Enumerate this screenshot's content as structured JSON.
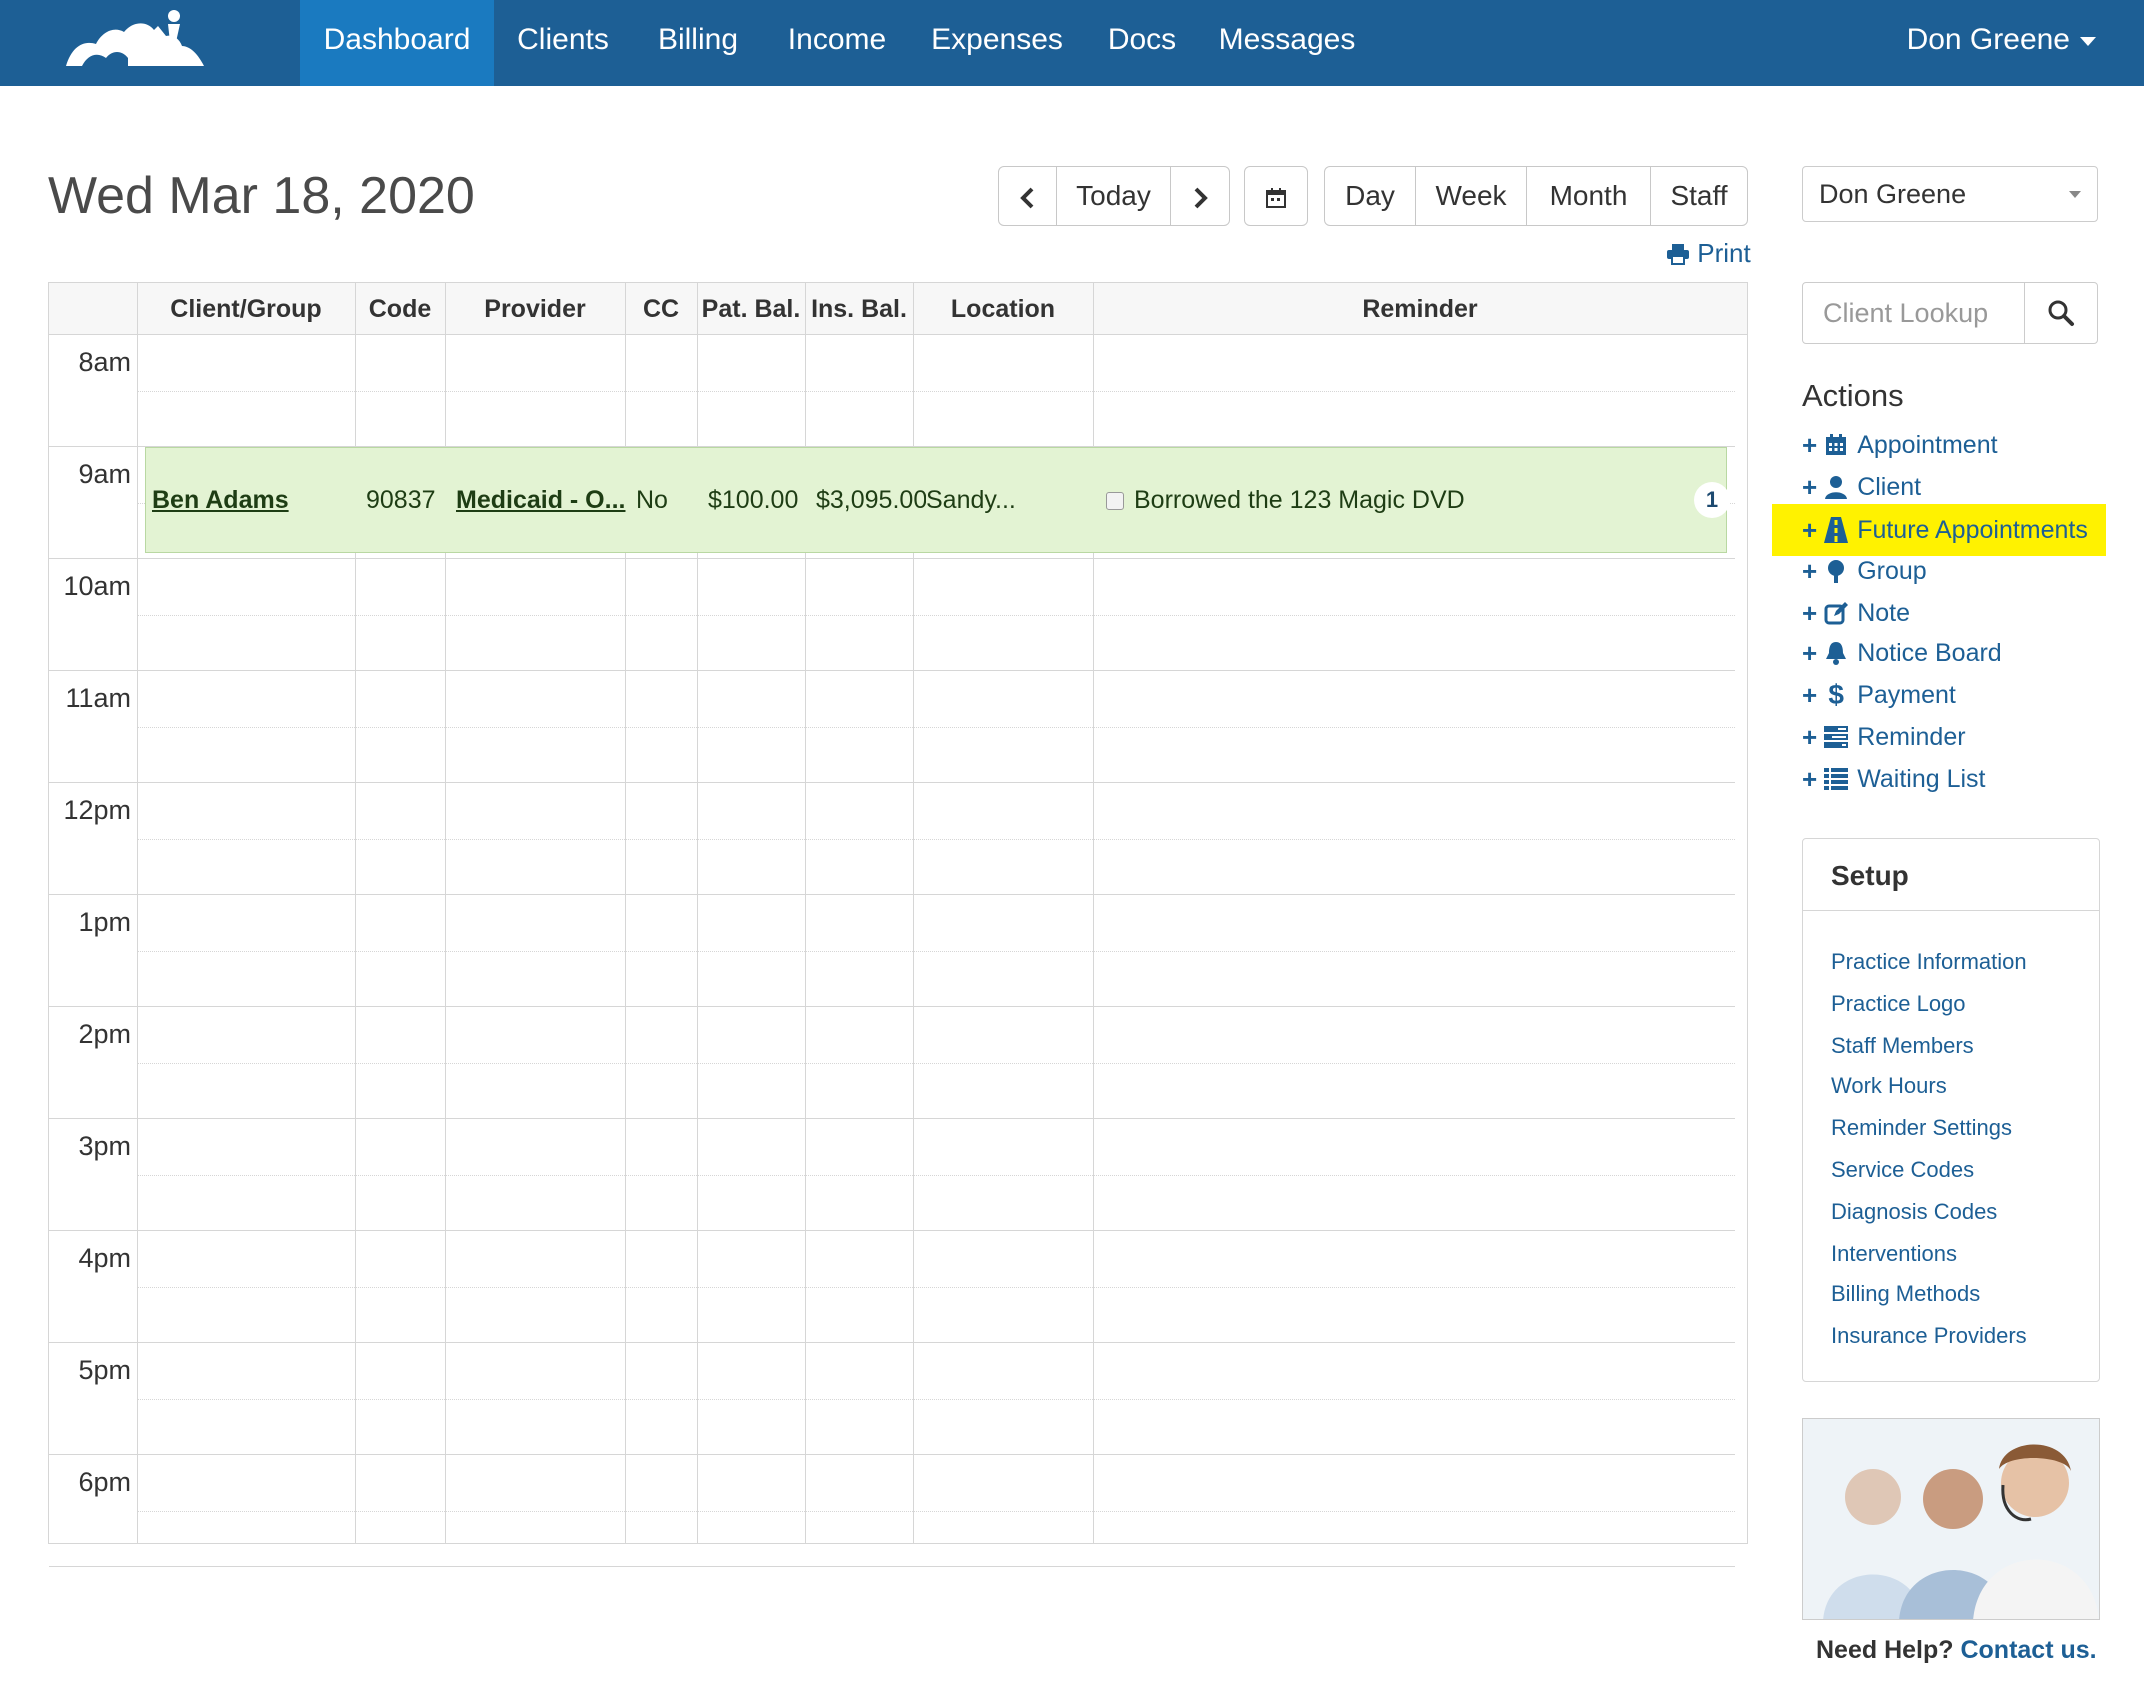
{
  "nav": {
    "items": [
      {
        "label": "Dashboard",
        "active": true
      },
      {
        "label": "Clients"
      },
      {
        "label": "Billing"
      },
      {
        "label": "Income"
      },
      {
        "label": "Expenses"
      },
      {
        "label": "Docs"
      },
      {
        "label": "Messages"
      }
    ],
    "user": "Don Greene"
  },
  "date_title": "Wed Mar 18, 2020",
  "toolbar": {
    "today": "Today",
    "views": [
      "Day",
      "Week",
      "Month",
      "Staff"
    ],
    "print": "Print"
  },
  "calendar": {
    "columns": [
      "Client/Group",
      "Code",
      "Provider",
      "CC",
      "Pat. Bal.",
      "Ins. Bal.",
      "Location",
      "Reminder"
    ],
    "hours": [
      "8am",
      "9am",
      "10am",
      "11am",
      "12pm",
      "1pm",
      "2pm",
      "3pm",
      "4pm",
      "5pm",
      "6pm"
    ],
    "appointment": {
      "client": "Ben Adams",
      "code": "90837",
      "provider": "Medicaid - O...",
      "cc": "No",
      "pat_bal": "$100.00",
      "ins_bal": "$3,095.00",
      "location": "Sandy...",
      "reminder": "Borrowed the 123 Magic DVD",
      "count": "1"
    }
  },
  "sidebar": {
    "staff_select": "Don Greene",
    "lookup_placeholder": "Client Lookup",
    "actions_title": "Actions",
    "actions": [
      {
        "label": "Appointment",
        "icon": "calendar-icon"
      },
      {
        "label": "Client",
        "icon": "user-icon"
      },
      {
        "label": "Future Appointments",
        "icon": "road-icon",
        "highlight": true
      },
      {
        "label": "Group",
        "icon": "tree-icon"
      },
      {
        "label": "Note",
        "icon": "edit-icon"
      },
      {
        "label": "Notice Board",
        "icon": "bell-icon"
      },
      {
        "label": "Payment",
        "icon": "dollar-icon"
      },
      {
        "label": "Reminder",
        "icon": "tasks-icon"
      },
      {
        "label": "Waiting List",
        "icon": "list-icon"
      }
    ],
    "setup_title": "Setup",
    "setup_links": [
      "Practice Information",
      "Practice Logo",
      "Staff Members",
      "Work Hours",
      "Reminder Settings",
      "Service Codes",
      "Diagnosis Codes",
      "Interventions",
      "Billing Methods",
      "Insurance Providers"
    ],
    "help_prefix": "Need Help?",
    "help_link": "Contact us."
  },
  "colors": {
    "nav_bg": "#1d5f95",
    "nav_active": "#1a7ac0",
    "link": "#1d5f95",
    "appointment_bg": "#e3f3d3",
    "highlight": "#fff200"
  }
}
